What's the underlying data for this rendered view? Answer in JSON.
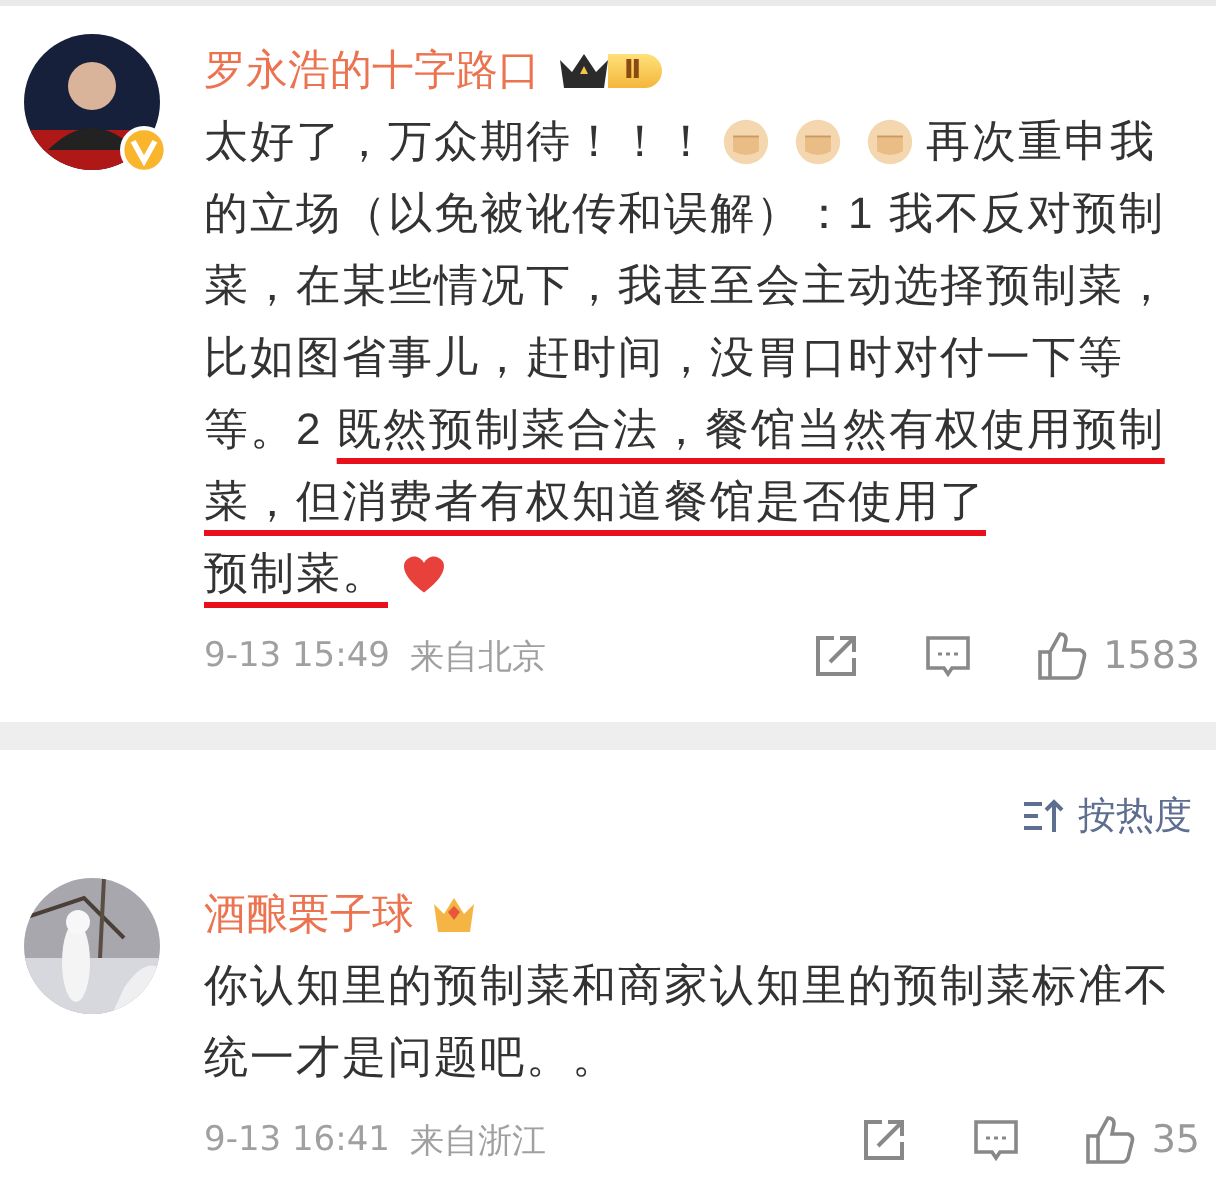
{
  "comments": [
    {
      "author": "罗永浩的十字路口",
      "verified": true,
      "badge": {
        "kind": "crown_level",
        "text": "Ⅱ"
      },
      "avatar": {
        "kind": "person"
      },
      "blocks": [
        [
          {
            "kind": "text",
            "text": "太好了，万众期待！！！"
          },
          {
            "kind": "fist"
          },
          {
            "kind": "fist"
          },
          {
            "kind": "fist"
          },
          {
            "kind": "text",
            "text": "再次重申我"
          }
        ],
        [
          {
            "kind": "text",
            "text": "的立场（以免被讹传和误解）：1 我不反对预制菜，在某些情况下，我甚至会主动选择预制菜，比如图省事儿，赶时间，没胃口时对付一下等等。2 ",
            "underlined": "既然预制菜合法，餐馆当然有权使用预制菜，但消费者有权知道餐馆是否使用了"
          }
        ],
        [
          {
            "kind": "text",
            "underlined": "预制菜。"
          },
          {
            "kind": "heart"
          }
        ]
      ],
      "time": "9-13 15:49",
      "source": "来自北京",
      "likes": "1583"
    },
    {
      "author": "酒酿栗子球",
      "verified": false,
      "badge": {
        "kind": "gem_crown"
      },
      "avatar": {
        "kind": "picture"
      },
      "blocks": [
        [
          {
            "kind": "text",
            "text": "你认知里的预制菜和商家认知里的预制菜标准不统一才是问题吧。。"
          }
        ]
      ],
      "time": "9-13 16:41",
      "source": "来自浙江",
      "likes": "35"
    }
  ],
  "sort": {
    "label": "按热度"
  }
}
